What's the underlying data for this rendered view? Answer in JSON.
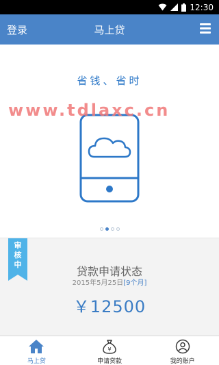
{
  "status_bar": {
    "time": "12:30"
  },
  "header": {
    "login_label": "登录",
    "title": "马上贷",
    "menu_icon": "menu-icon"
  },
  "banner": {
    "slogan": "省钱、省时",
    "watermark": "www.tdlaxc.cn",
    "illustration_icon": "phone-cloud-icon",
    "slide_count": 4,
    "active_slide": 2
  },
  "loan_status": {
    "badge": [
      "审",
      "核",
      "中"
    ],
    "title": "贷款申请状态",
    "date": "2015年5月25日",
    "term": "[9个月]",
    "amount": "￥12500"
  },
  "tabs": [
    {
      "label": "马上贷",
      "icon": "home-icon",
      "active": true
    },
    {
      "label": "申请贷款",
      "icon": "money-bag-icon",
      "active": false
    },
    {
      "label": "我的账户",
      "icon": "user-icon",
      "active": false
    }
  ],
  "colors": {
    "primary": "#4a84c8",
    "badge": "#4fb3e8",
    "watermark": "#f07878"
  }
}
